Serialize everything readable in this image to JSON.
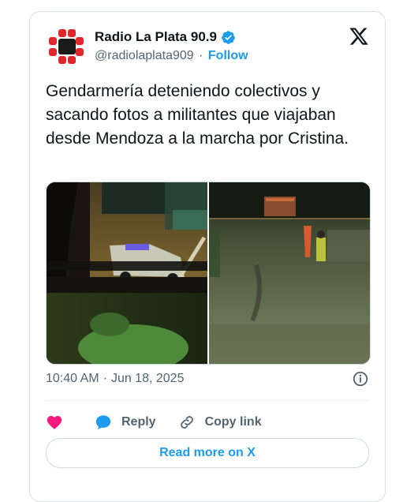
{
  "author": {
    "name": "Radio La Plata 90.9",
    "handle": "@radiolaplata909",
    "separator": "·",
    "follow_label": "Follow",
    "verified": true
  },
  "tweet": {
    "text": "Gendarmería deteniendo colectivos y sacando fotos a militantes que viajaban desde Mendoza a la marcha por Cristina."
  },
  "media": {
    "count": 2,
    "photos": [
      "bus-window-police-truck-photo",
      "highway-checkpoint-photo"
    ]
  },
  "meta": {
    "time": "10:40 AM",
    "separator": "·",
    "date": "Jun 18, 2025"
  },
  "actions": {
    "reply_label": "Reply",
    "copy_link_label": "Copy link",
    "read_more_label": "Read more on X"
  },
  "colors": {
    "accent": "#1d9bf0",
    "heart": "#f91880",
    "text": "#0f1419",
    "muted": "#536471"
  }
}
